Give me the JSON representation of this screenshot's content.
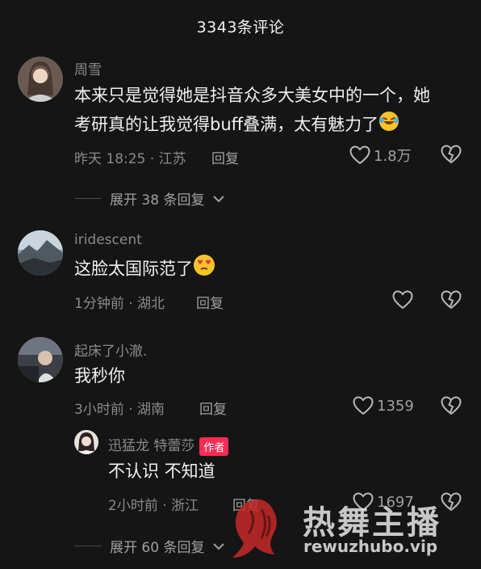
{
  "header": {
    "title": "3343条评论"
  },
  "comments": [
    {
      "username": "周雪",
      "text_line1": "本来只是觉得她是抖音众多大美女中的一个，她",
      "text_line2": "考研真的让我觉得buff叠满，太有魅力了",
      "time_location": "昨天 18:25 · 江苏",
      "reply_label": "回复",
      "likes": "1.8万",
      "expand_label": "展开 38 条回复"
    },
    {
      "username": "iridescent",
      "text": "这脸太国际范了",
      "time_location": "1分钟前 · 湖北",
      "reply_label": "回复"
    },
    {
      "username": "起床了小澈.",
      "text": "我秒你",
      "time_location": "3小时前 · 湖南",
      "reply_label": "回复",
      "likes": "1359"
    }
  ],
  "reply": {
    "username": "迅猛龙 特蕾莎",
    "author_badge": "作者",
    "text": "不认识 不知道",
    "time_location": "2小时前 · 浙江",
    "reply_label": "回复",
    "likes": "1697"
  },
  "expand2": {
    "label": "展开 60 条回复"
  },
  "watermark": {
    "title": "热舞主播",
    "url": "rewuzhubo.vip"
  },
  "colors": {
    "background": "#151515",
    "badge": "#fe2c55",
    "muted": "#8a8a8a"
  }
}
